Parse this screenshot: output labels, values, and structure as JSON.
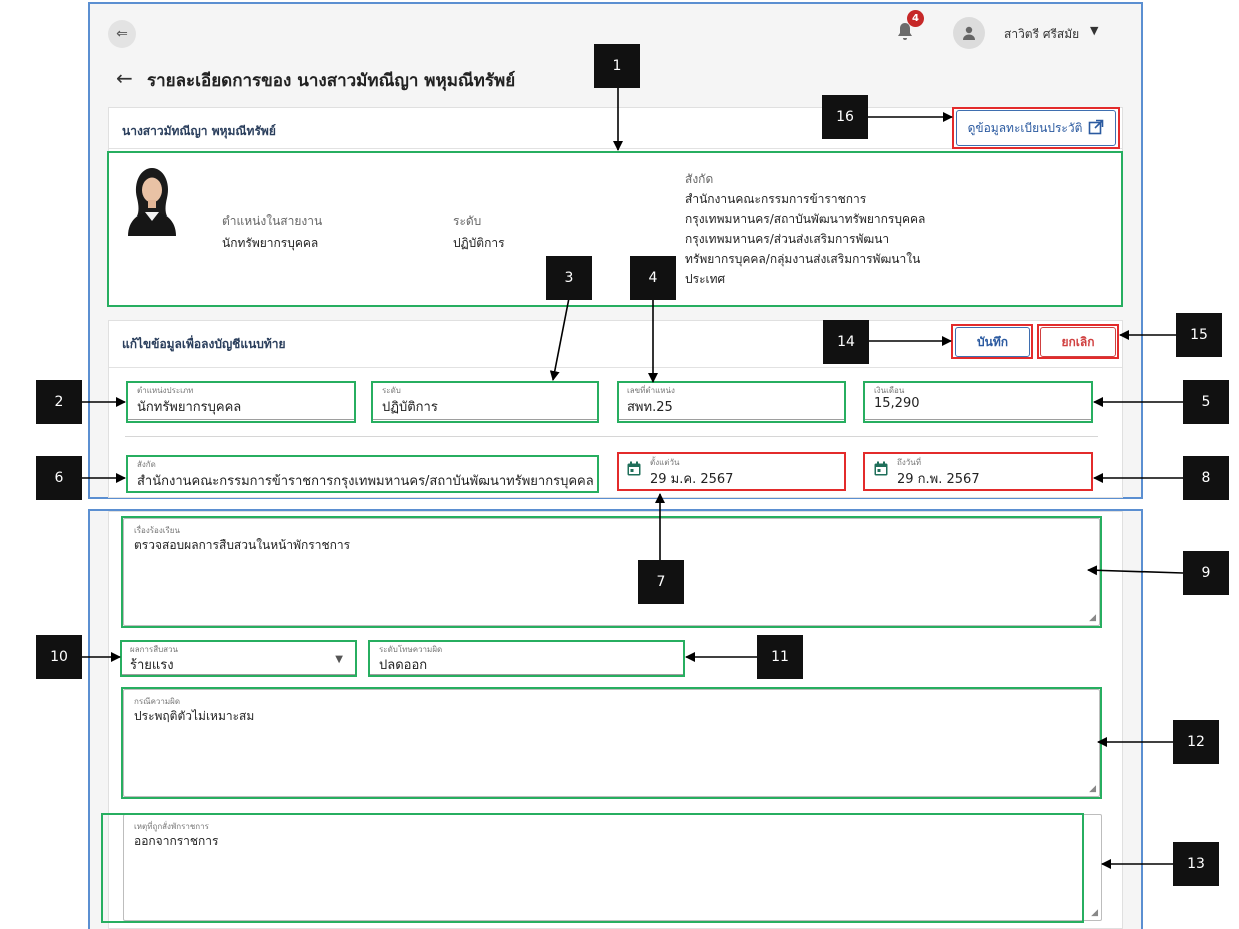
{
  "header": {
    "notification_count": "4",
    "user_name": "สาวิตรี ศรีสมัย",
    "page_title": "รายละเอียดการของ นางสาวมัทณีญา พหุมณีทรัพย์"
  },
  "info_card": {
    "name": "นางสาวมัทณีญา พหุมณีทรัพย์",
    "record_button": "ดูข้อมูลทะเบียนประวัติ",
    "position_label": "ตำแหน่งในสายงาน",
    "position_value": "นักทรัพยากรบุคคล",
    "level_label": "ระดับ",
    "level_value": "ปฏิบัติการ",
    "dept_label": "สังกัด",
    "dept_value": "สำนักงานคณะกรรมการข้าราชการกรุงเทพมหานคร/สถาบันพัฒนาทรัพยากรบุคคลกรุงเทพมหานคร/ส่วนส่งเสริมการพัฒนาทรัพยากรบุคคล/กลุ่มงานส่งเสริมการพัฒนาในประเทศ"
  },
  "edit_card": {
    "title": "แก้ไขข้อมูลเพื่อลงบัญชีแนบท้าย",
    "save_label": "บันทึก",
    "cancel_label": "ยกเลิก",
    "position_type": {
      "label": "ตำแหน่งประเภท",
      "value": "นักทรัพยากรบุคคล"
    },
    "level": {
      "label": "ระดับ",
      "value": "ปฏิบัติการ"
    },
    "position_no": {
      "label": "เลขที่ตำแหน่ง",
      "value": "สพท.25"
    },
    "salary": {
      "label": "เงินเดือน",
      "value": "15,290"
    },
    "affiliation": {
      "label": "สังกัด",
      "value": "สำนักงานคณะกรรมการข้าราชการกรุงเทพมหานคร/สถาบันพัฒนาทรัพยากรบุคคลกรุ"
    },
    "start_date": {
      "label": "ตั้งแต่วัน",
      "value": "29 ม.ค. 2567"
    },
    "end_date": {
      "label": "ถึงวันที่",
      "value": "29 ก.พ. 2567"
    },
    "complaint": {
      "label": "เรื่องร้องเรียน",
      "value": "ตรวจสอบผลการสืบสวนในหน้าพักราชการ"
    },
    "investigation_result": {
      "label": "ผลการสืบสวน",
      "value": "ร้ายแรง"
    },
    "penalty_level": {
      "label": "ระดับโทษความผิด",
      "value": "ปลดออก"
    },
    "offense": {
      "label": "กรณีความผิด",
      "value": "ประพฤติตัวไม่เหมาะสม"
    },
    "suspension_reason": {
      "label": "เหตุที่ถูกสั่งพักราชการ",
      "value": "ออกจากราชการ"
    }
  },
  "annotations": [
    "1",
    "2",
    "3",
    "4",
    "5",
    "6",
    "7",
    "8",
    "9",
    "10",
    "11",
    "12",
    "13",
    "14",
    "15",
    "16"
  ],
  "colors": {
    "green_box": "#27ae60",
    "red_box": "#e32b2b",
    "panel_border": "#5b8fd1",
    "primary": "#2b5aa0",
    "danger": "#d04040"
  },
  "icons": [
    "menu-collapse-icon",
    "bell-icon",
    "user-icon",
    "caret-down-icon",
    "back-arrow-icon",
    "external-link-icon",
    "calendar-icon",
    "resize-icon"
  ]
}
